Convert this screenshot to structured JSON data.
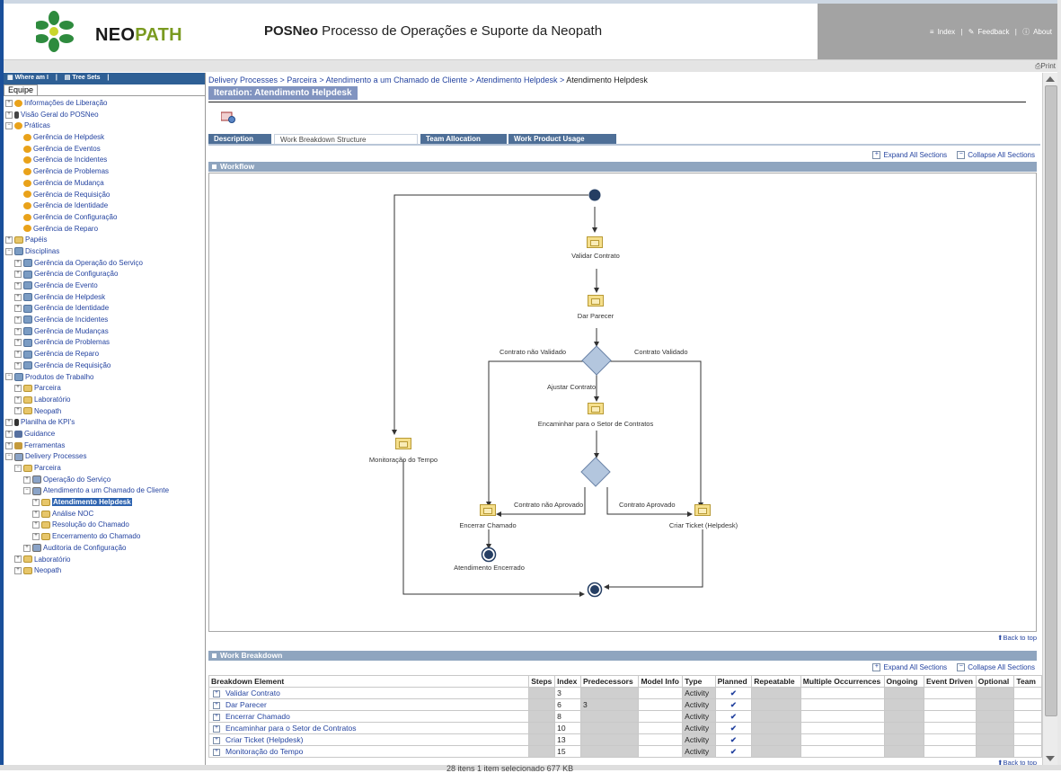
{
  "header": {
    "logo_word_a": "NEO",
    "logo_word_b": "PATH",
    "app_title_bold": "POSNeo",
    "app_title_rest": " Processo de Operações e Suporte da Neopath",
    "links": {
      "index": "Index",
      "feedback": "Feedback",
      "about": "About"
    },
    "print": "Print"
  },
  "left": {
    "toolbar": {
      "where_am_i": "Where am I",
      "tree_sets": "Tree Sets"
    },
    "tab": "Equipe",
    "tree": [
      {
        "label": "Informações de Liberação",
        "level": 0,
        "exp": "+",
        "icon": "gold"
      },
      {
        "label": "Visão Geral do POSNeo",
        "level": 0,
        "exp": "+",
        "icon": "person"
      },
      {
        "label": "Práticas",
        "level": 0,
        "exp": "-",
        "icon": "gold"
      },
      {
        "label": "Gerência de Helpdesk",
        "level": 1,
        "exp": "",
        "icon": "gold"
      },
      {
        "label": "Gerência de Eventos",
        "level": 1,
        "exp": "",
        "icon": "gold"
      },
      {
        "label": "Gerência de Incidentes",
        "level": 1,
        "exp": "",
        "icon": "gold"
      },
      {
        "label": "Gerência de Problemas",
        "level": 1,
        "exp": "",
        "icon": "gold"
      },
      {
        "label": "Gerência de Mudança",
        "level": 1,
        "exp": "",
        "icon": "gold"
      },
      {
        "label": "Gerência de Requisição",
        "level": 1,
        "exp": "",
        "icon": "gold"
      },
      {
        "label": "Gerência de Identidade",
        "level": 1,
        "exp": "",
        "icon": "gold"
      },
      {
        "label": "Gerência de Configuração",
        "level": 1,
        "exp": "",
        "icon": "gold"
      },
      {
        "label": "Gerência de Reparo",
        "level": 1,
        "exp": "",
        "icon": "gold"
      },
      {
        "label": "Papéis",
        "level": 0,
        "exp": "+",
        "icon": "folder"
      },
      {
        "label": "Disciplinas",
        "level": 0,
        "exp": "-",
        "icon": "disc"
      },
      {
        "label": "Gerência da Operação do Serviço",
        "level": 1,
        "exp": "+",
        "icon": "disc"
      },
      {
        "label": "Gerência de Configuração",
        "level": 1,
        "exp": "+",
        "icon": "disc"
      },
      {
        "label": "Gerência de Evento",
        "level": 1,
        "exp": "+",
        "icon": "disc"
      },
      {
        "label": "Gerência de Helpdesk",
        "level": 1,
        "exp": "+",
        "icon": "disc"
      },
      {
        "label": "Gerência de Identidade",
        "level": 1,
        "exp": "+",
        "icon": "disc"
      },
      {
        "label": "Gerência de Incidentes",
        "level": 1,
        "exp": "+",
        "icon": "disc"
      },
      {
        "label": "Gerência de Mudanças",
        "level": 1,
        "exp": "+",
        "icon": "disc"
      },
      {
        "label": "Gerência de Problemas",
        "level": 1,
        "exp": "+",
        "icon": "disc"
      },
      {
        "label": "Gerência de Reparo",
        "level": 1,
        "exp": "+",
        "icon": "disc"
      },
      {
        "label": "Gerência de Requisição",
        "level": 1,
        "exp": "+",
        "icon": "disc"
      },
      {
        "label": "Produtos de Trabalho",
        "level": 0,
        "exp": "-",
        "icon": "disc"
      },
      {
        "label": "Parceira",
        "level": 1,
        "exp": "+",
        "icon": "folder"
      },
      {
        "label": "Laboratório",
        "level": 1,
        "exp": "+",
        "icon": "folder"
      },
      {
        "label": "Neopath",
        "level": 1,
        "exp": "+",
        "icon": "folder"
      },
      {
        "label": "Planilha de KPI's",
        "level": 0,
        "exp": "+",
        "icon": "kpi"
      },
      {
        "label": "Guidance",
        "level": 0,
        "exp": "+",
        "icon": "book"
      },
      {
        "label": "Ferramentas",
        "level": 0,
        "exp": "+",
        "icon": "tool"
      },
      {
        "label": "Delivery Processes",
        "level": 0,
        "exp": "-",
        "icon": "proc"
      },
      {
        "label": "Parceira",
        "level": 1,
        "exp": "-",
        "icon": "folder"
      },
      {
        "label": "Operação do Serviço",
        "level": 2,
        "exp": "+",
        "icon": "proc"
      },
      {
        "label": "Atendimento a um Chamado de Cliente",
        "level": 2,
        "exp": "-",
        "icon": "proc"
      },
      {
        "label": "Atendimento Helpdesk",
        "level": 3,
        "exp": "+",
        "icon": "folder",
        "selected": true
      },
      {
        "label": "Análise NOC",
        "level": 3,
        "exp": "+",
        "icon": "folder"
      },
      {
        "label": "Resolução do Chamado",
        "level": 3,
        "exp": "+",
        "icon": "folder"
      },
      {
        "label": "Encerramento do Chamado",
        "level": 3,
        "exp": "+",
        "icon": "folder"
      },
      {
        "label": "Auditoria de Configuração",
        "level": 2,
        "exp": "+",
        "icon": "proc"
      },
      {
        "label": "Laboratório",
        "level": 1,
        "exp": "+",
        "icon": "folder"
      },
      {
        "label": "Neopath",
        "level": 1,
        "exp": "+",
        "icon": "folder"
      }
    ]
  },
  "main": {
    "breadcrumb": {
      "items": [
        "Delivery Processes",
        "Parceira",
        "Atendimento a um Chamado de Cliente",
        "Atendimento Helpdesk"
      ],
      "current": "Atendimento Helpdesk",
      "sep": " > "
    },
    "title": "Iteration: Atendimento Helpdesk",
    "tabs": [
      "Description",
      "Work Breakdown Structure",
      "Team Allocation",
      "Work Product Usage"
    ],
    "expand_all": "Expand All Sections",
    "collapse_all": "Collapse All Sections",
    "workflow_title": "Workflow",
    "back_to_top": "Back to top",
    "work_breakdown_title": "Work Breakdown",
    "diagram": {
      "activities": {
        "validar": "Validar Contrato",
        "parecer": "Dar Parecer",
        "encaminhar": "Encaminhar para o Setor de Contratos",
        "monitoracao": "Monitoração do Tempo",
        "encerrar": "Encerrar Chamado",
        "criar": "Criar Ticket (Helpdesk)"
      },
      "labels": {
        "nao_validado": "Contrato não Validado",
        "validado": "Contrato Validado",
        "ajustar": "Ajustar Contrato",
        "nao_aprovado": "Contrato não Aprovado",
        "aprovado": "Contrato Aprovado",
        "encerrado": "Atendimento Encerrado"
      }
    },
    "table": {
      "columns": [
        "Breakdown Element",
        "Steps",
        "Index",
        "Predecessors",
        "Model Info",
        "Type",
        "Planned",
        "Repeatable",
        "Multiple Occurrences",
        "Ongoing",
        "Event Driven",
        "Optional",
        "Team"
      ],
      "rows": [
        {
          "element": "Validar Contrato",
          "index": "3",
          "predecessors": "",
          "type": "Activity",
          "planned": "✔"
        },
        {
          "element": "Dar Parecer",
          "index": "6",
          "predecessors": "3",
          "type": "Activity",
          "planned": "✔"
        },
        {
          "element": "Encerrar Chamado",
          "index": "8",
          "predecessors": "",
          "type": "Activity",
          "planned": "✔"
        },
        {
          "element": "Encaminhar para o Setor de Contratos",
          "index": "10",
          "predecessors": "",
          "type": "Activity",
          "planned": "✔"
        },
        {
          "element": "Criar Ticket (Helpdesk)",
          "index": "13",
          "predecessors": "",
          "type": "Activity",
          "planned": "✔"
        },
        {
          "element": "Monitoração do Tempo",
          "index": "15",
          "predecessors": "",
          "type": "Activity",
          "planned": "✔"
        }
      ]
    }
  },
  "background": {
    "status_text": "28 itens    1 item selecionado  677 KB"
  },
  "colors": {
    "header_gray": "#a3a3a3",
    "nav_blue": "#2e5f95",
    "section_blue": "#8fa5bf",
    "tab_blue": "#4e6f97",
    "link": "#2544a0"
  }
}
